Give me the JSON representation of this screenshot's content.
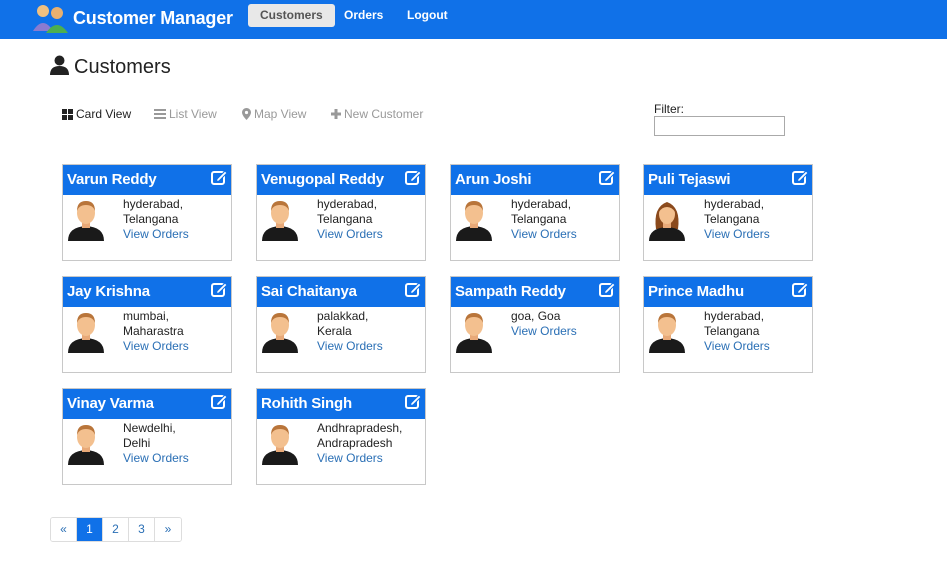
{
  "navbar": {
    "brand": "Customer Manager",
    "links": [
      "Customers",
      "Orders",
      "Logout"
    ]
  },
  "header": {
    "title": "Customers"
  },
  "views": {
    "card": "Card View",
    "list": "List View",
    "map": "Map View",
    "new": "New Customer"
  },
  "filter": {
    "label": "Filter:",
    "value": ""
  },
  "colors": {
    "brand": "#1071e8",
    "link": "#2a6fb5"
  },
  "customers": [
    {
      "name": "Varun Reddy",
      "city": "hyderabad,",
      "state": "Telangana",
      "orders_link": "View Orders",
      "gender": "male"
    },
    {
      "name": "Venugopal Reddy",
      "city": "hyderabad,",
      "state": "Telangana",
      "orders_link": "View Orders",
      "gender": "male"
    },
    {
      "name": "Arun Joshi",
      "city": "hyderabad,",
      "state": "Telangana",
      "orders_link": "View Orders",
      "gender": "male"
    },
    {
      "name": "Puli Tejaswi",
      "city": "hyderabad,",
      "state": "Telangana",
      "orders_link": "View Orders",
      "gender": "female"
    },
    {
      "name": "Jay Krishna",
      "city": "mumbai,",
      "state": "Maharastra",
      "orders_link": "View Orders",
      "gender": "male"
    },
    {
      "name": "Sai Chaitanya",
      "city": "palakkad,",
      "state": "Kerala",
      "orders_link": "View Orders",
      "gender": "male"
    },
    {
      "name": "Sampath Reddy",
      "city": "goa, Goa",
      "state": "",
      "orders_link": "View Orders",
      "gender": "male"
    },
    {
      "name": "Prince Madhu",
      "city": "hyderabad,",
      "state": "Telangana",
      "orders_link": "View Orders",
      "gender": "male"
    },
    {
      "name": "Vinay Varma",
      "city": "Newdelhi,",
      "state": "Delhi",
      "orders_link": "View Orders",
      "gender": "male"
    },
    {
      "name": "Rohith Singh",
      "city": "Andhrapradesh,",
      "state": "Andrapradesh",
      "orders_link": "View Orders",
      "gender": "male"
    }
  ],
  "pagination": {
    "prev": "«",
    "pages": [
      "1",
      "2",
      "3"
    ],
    "next": "»",
    "current": "1"
  }
}
